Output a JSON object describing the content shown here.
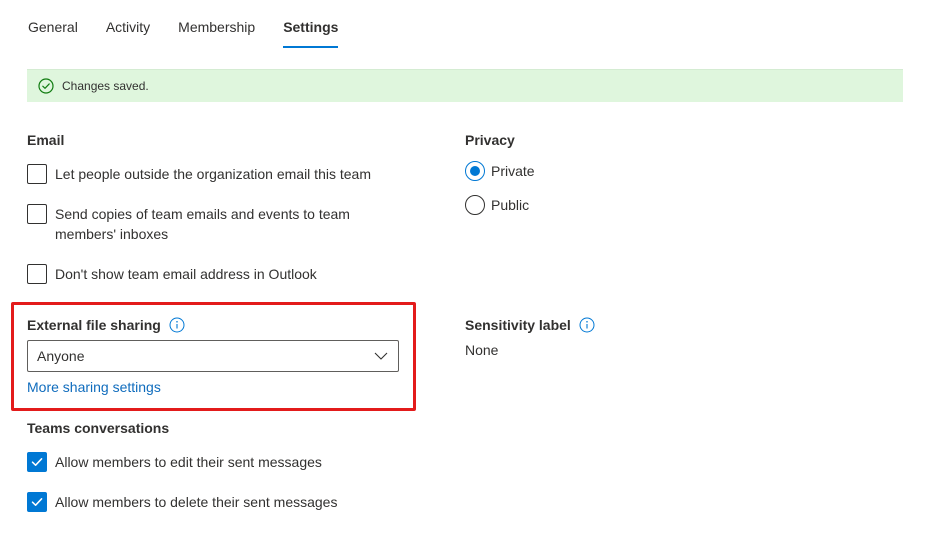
{
  "tabs": [
    {
      "label": "General",
      "active": false
    },
    {
      "label": "Activity",
      "active": false
    },
    {
      "label": "Membership",
      "active": false
    },
    {
      "label": "Settings",
      "active": true
    }
  ],
  "banner": {
    "text": "Changes saved.",
    "icon": "check-circle-icon",
    "color": "#dff6dd"
  },
  "email": {
    "title": "Email",
    "options": [
      {
        "label": "Let people outside the organization email this team",
        "checked": false
      },
      {
        "label_line1": "Send copies of team emails and events to team",
        "label_line2": "members' inboxes",
        "checked": false
      },
      {
        "label": "Don't show team email address in Outlook",
        "checked": false
      }
    ]
  },
  "privacy": {
    "title": "Privacy",
    "options": [
      {
        "label": "Private",
        "selected": true
      },
      {
        "label": "Public",
        "selected": false
      }
    ]
  },
  "external_sharing": {
    "title": "External file sharing",
    "selected": "Anyone",
    "link": "More sharing settings"
  },
  "sensitivity": {
    "title": "Sensitivity label",
    "value": "None"
  },
  "teams_conversations": {
    "title": "Teams conversations",
    "options": [
      {
        "label": "Allow members to edit their sent messages",
        "checked": true
      },
      {
        "label": "Allow members to delete their sent messages",
        "checked": true
      }
    ]
  },
  "colors": {
    "accent": "#0078d4",
    "highlight": "#e31b1b",
    "link": "#0f6cbd"
  }
}
